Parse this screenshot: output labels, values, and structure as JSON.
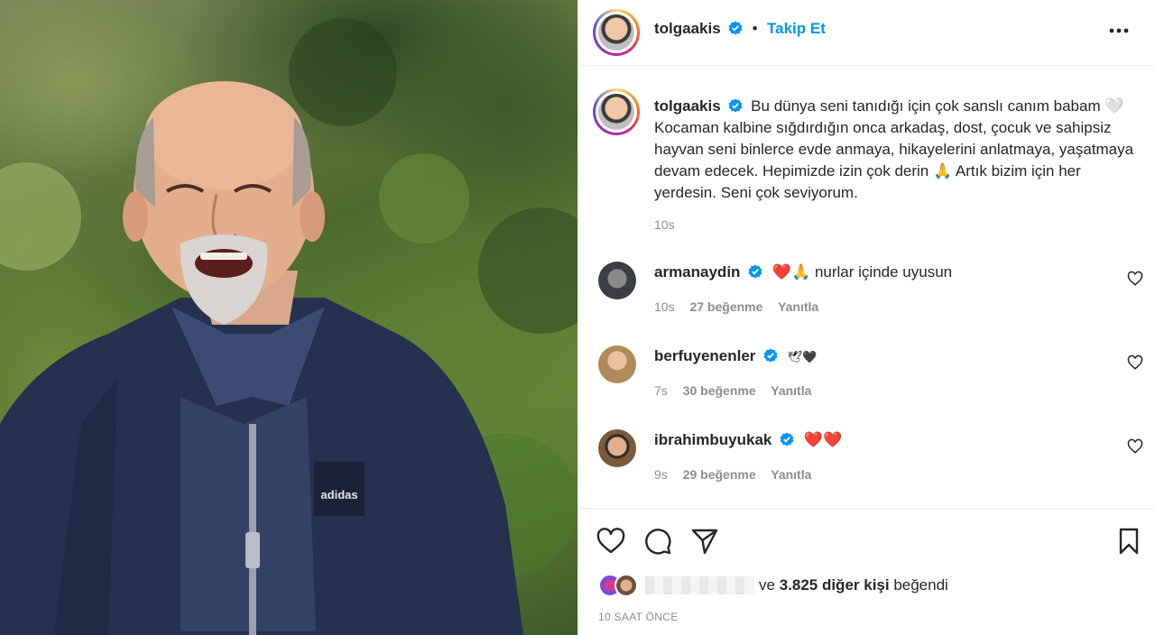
{
  "post": {
    "username": "tolgaakis",
    "follow_label": "Takip Et",
    "caption": "Bu dünya seni tanıdığı için çok sanslı canım babam 🤍 Kocaman kalbine sığdırdığın onca arkadaş, dost, çocuk ve sahipsiz hayvan seni binlerce evde anmaya, hikayelerini anlatmaya, yaşatmaya devam edecek. Hepimizde izin çok derin 🙏 Artık bizim için her yerdesin. Seni çok seviyorum.",
    "caption_time": "10s",
    "likes_text": "ve 3.825 diğer kişi beğendi",
    "posted_ago": "10 SAAT ÖNCE"
  },
  "comments": [
    {
      "username": "armanaydin",
      "text": "❤️🙏 nurlar içinde uyusun",
      "time": "10s",
      "likes": "27 beğenme",
      "reply": "Yanıtla"
    },
    {
      "username": "berfuyenenler",
      "text": "🕊🖤",
      "time": "7s",
      "likes": "30 beğenme",
      "reply": "Yanıtla"
    },
    {
      "username": "ibrahimbuyukak",
      "text": "❤️❤️",
      "time": "9s",
      "likes": "29 beğenme",
      "reply": "Yanıtla"
    }
  ],
  "icons": {
    "verified": "verified-badge-icon",
    "more": "more-options-icon",
    "like": "heart-icon",
    "comment": "comment-icon",
    "share": "share-icon",
    "save": "bookmark-icon"
  },
  "colors": {
    "accent": "#0095f6",
    "verified": "#0095f6",
    "muted": "#8e8e8e"
  }
}
